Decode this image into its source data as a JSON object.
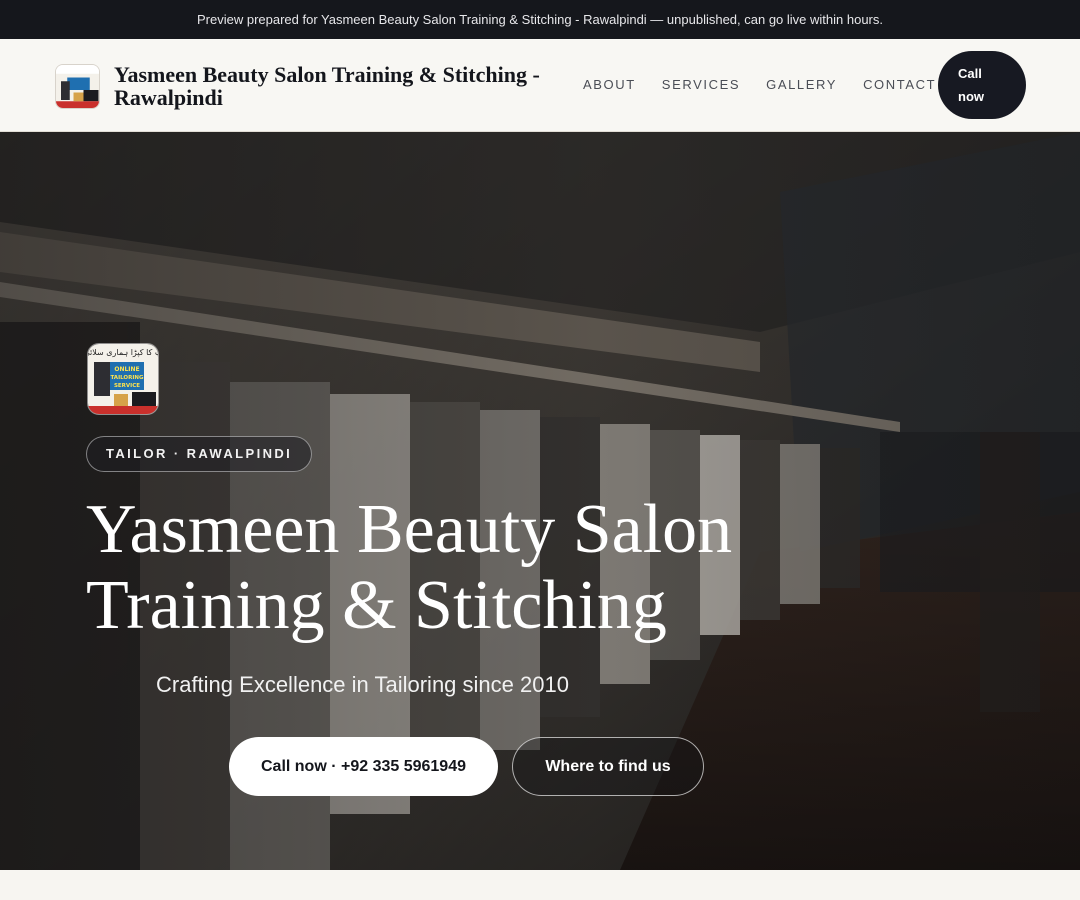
{
  "preview_bar": {
    "text": "Preview prepared for Yasmeen Beauty Salon Training & Stitching - Rawalpindi — unpublished, can go live within hours."
  },
  "header": {
    "brand_name": "Yasmeen Beauty Salon Training & Stitching - Rawalpindi",
    "nav": [
      {
        "label": "ABOUT"
      },
      {
        "label": "SERVICES"
      },
      {
        "label": "GALLERY"
      },
      {
        "label": "CONTACT"
      }
    ],
    "call_button": "Call now"
  },
  "hero": {
    "badge": "TAILOR · RAWALPINDI",
    "title_line1": "Yasmeen Beauty Salon",
    "title_line2": "Training & Stitching",
    "tagline": "Crafting Excellence in Tailoring since 2010",
    "primary_button": "Call now · +92 335 5961949",
    "secondary_button": "Where to find us"
  },
  "logo": {
    "urdu_text": "آپ کا کپڑا ہماری سلائی",
    "english_text_1": "ONLINE",
    "english_text_2": "TAILORING",
    "english_text_3": "SERVICE"
  },
  "colors": {
    "dark": "#15171c",
    "header_bg": "#f8f7f3",
    "accent_white": "#ffffff"
  }
}
